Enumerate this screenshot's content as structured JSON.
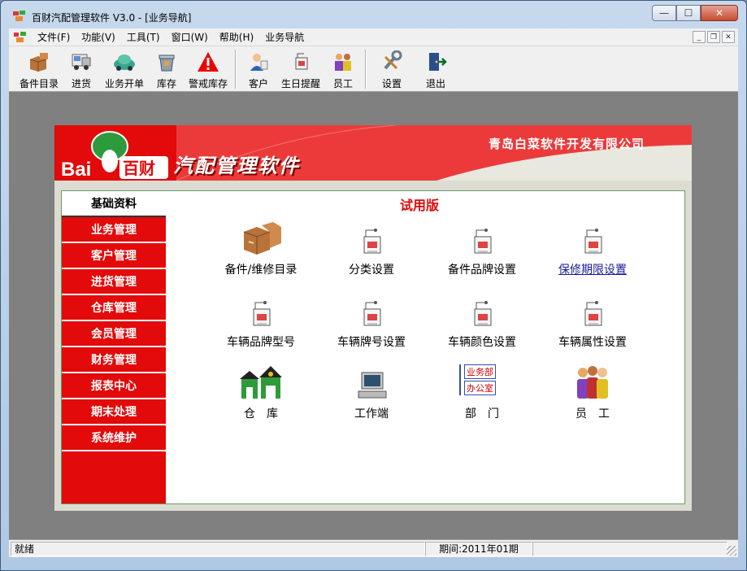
{
  "window": {
    "title": "百财汽配管理软件 V3.0 - [业务导航]",
    "controls": {
      "minimize": "—",
      "maximize": "☐",
      "close": "✕"
    }
  },
  "menubar": {
    "items": [
      "文件(F)",
      "功能(V)",
      "工具(T)",
      "窗口(W)",
      "帮助(H)",
      "业务导航"
    ],
    "mdi_controls": {
      "minimize": "_",
      "restore": "❐",
      "close": "✕"
    }
  },
  "toolbar": {
    "items": [
      {
        "label": "备件目录",
        "icon": "boxes-icon"
      },
      {
        "label": "进货",
        "icon": "truck-icon"
      },
      {
        "label": "业务开单",
        "icon": "car-icon"
      },
      {
        "label": "库存",
        "icon": "bin-icon"
      },
      {
        "label": "警戒库存",
        "icon": "warning-icon"
      },
      {
        "label": "客户",
        "icon": "customer-icon"
      },
      {
        "label": "生日提醒",
        "icon": "bell-icon"
      },
      {
        "label": "员工",
        "icon": "staff-icon"
      },
      {
        "label": "设置",
        "icon": "tools-icon"
      },
      {
        "label": "退出",
        "icon": "exit-door-icon"
      }
    ]
  },
  "banner": {
    "company": "青岛白菜软件开发有限公司",
    "app_name": "汽配管理软件",
    "logo_text_en": "Bai",
    "logo_text_cn": "百财"
  },
  "sidebar": {
    "items": [
      "基础资料",
      "业务管理",
      "客户管理",
      "进货管理",
      "仓库管理",
      "会员管理",
      "财务管理",
      "报表中心",
      "期末处理",
      "系统维护"
    ],
    "active_index": 0
  },
  "main": {
    "trial_label": "试用版",
    "grid": [
      {
        "label": "备件/维修目录",
        "icon": "boxes-icon"
      },
      {
        "label": "分类设置",
        "icon": "printer-doc-icon"
      },
      {
        "label": "备件品牌设置",
        "icon": "printer-doc-icon"
      },
      {
        "label": "保修期限设置",
        "icon": "printer-doc-icon",
        "link": true
      },
      {
        "label": "车辆品牌型号",
        "icon": "printer-doc-icon"
      },
      {
        "label": "车辆牌号设置",
        "icon": "printer-doc-icon"
      },
      {
        "label": "车辆颜色设置",
        "icon": "printer-doc-icon"
      },
      {
        "label": "车辆属性设置",
        "icon": "printer-doc-icon"
      },
      {
        "label": "仓　库",
        "icon": "warehouse-icon"
      },
      {
        "label": "工作端",
        "icon": "computer-icon"
      },
      {
        "label": "部　门",
        "icon": "department-icon",
        "tags": [
          "业务部",
          "办公室"
        ]
      },
      {
        "label": "员　工",
        "icon": "staff-icon"
      }
    ]
  },
  "statusbar": {
    "status": "就绪",
    "period": "期间:2011年01期"
  },
  "colors": {
    "brand_red": "#e20a0a",
    "link_blue": "#1a1a9c"
  }
}
